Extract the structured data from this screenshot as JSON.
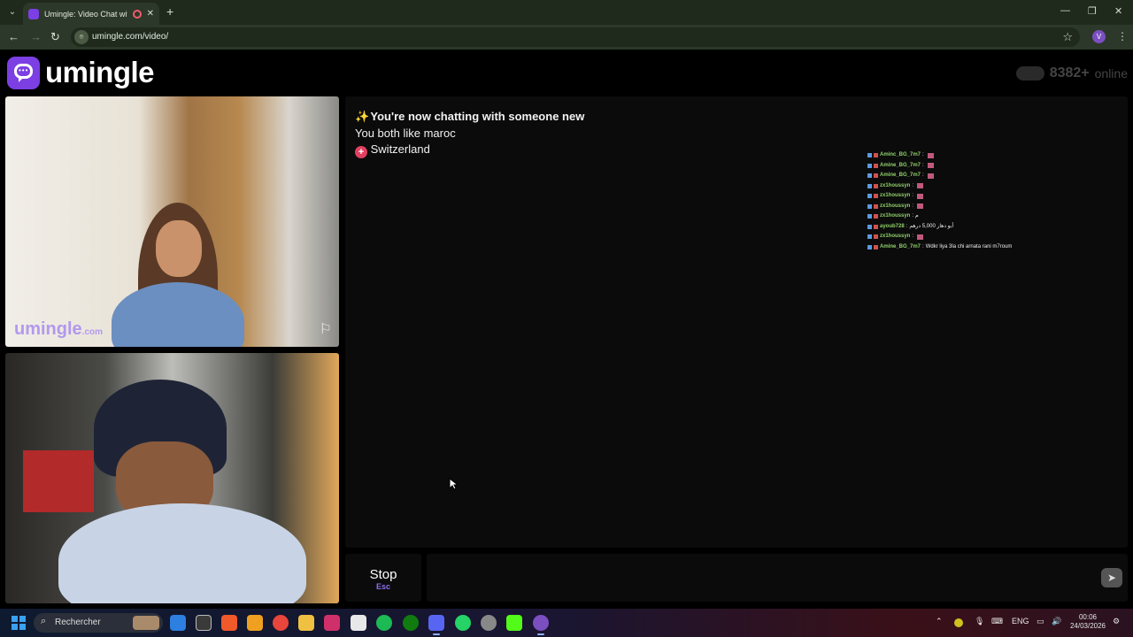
{
  "browser": {
    "tab_title": "Umingle: Video Chat with S",
    "url": "umingle.com/video/",
    "profile_initial": "V"
  },
  "header": {
    "brand": "umingle",
    "online_count": "8382+",
    "online_label": "online"
  },
  "video": {
    "watermark": "umingle",
    "watermark_suffix": ".com"
  },
  "chat": {
    "status_title": "You're now chatting with someone new",
    "common_interest": "You both like maroc",
    "country": "Switzerland",
    "overlay": [
      {
        "user": "Aminc_BG_7m7",
        "msg": ""
      },
      {
        "user": "Amine_BG_7m7",
        "msg": ""
      },
      {
        "user": "Amine_BG_7m7",
        "msg": ""
      },
      {
        "user": "zx1houssyn",
        "msg": ""
      },
      {
        "user": "zx1houssyn",
        "msg": ""
      },
      {
        "user": "zx1houssyn",
        "msg": ""
      },
      {
        "user": "zx1houssyn",
        "msg": "م"
      },
      {
        "user": "ayoub728",
        "msg": "أبو دهار 5,000 درهم"
      },
      {
        "user": "zx1houssyn",
        "msg": ""
      },
      {
        "user": "Amine_BG_7m7",
        "msg": "Wdkr liya 3la chi arnata rani m7roum"
      }
    ]
  },
  "controls": {
    "stop_label": "Stop",
    "stop_shortcut": "Esc",
    "input_value": ""
  },
  "taskbar": {
    "search_label": "Rechercher",
    "lang": "ENG",
    "time": "00:06",
    "date": "24/03/2026"
  }
}
